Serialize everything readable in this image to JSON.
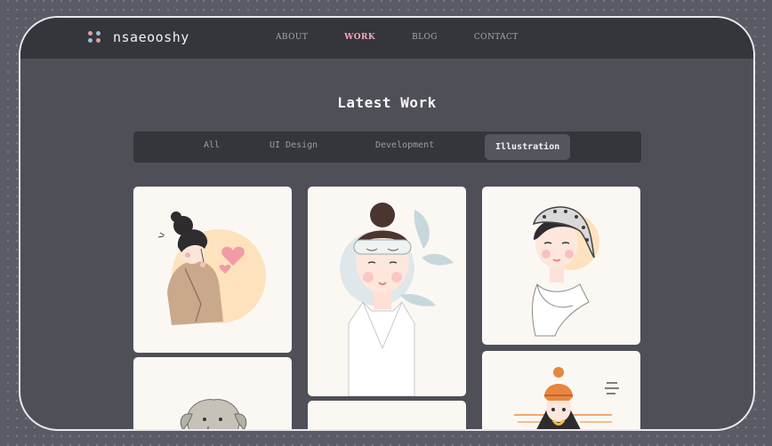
{
  "brand": {
    "name": "nsaeooshy"
  },
  "nav": [
    {
      "label": "ABOUT"
    },
    {
      "label": "WORK",
      "active": true
    },
    {
      "label": "BLOG"
    },
    {
      "label": "CONTACT"
    }
  ],
  "page": {
    "title": "Latest Work"
  },
  "filters": [
    {
      "label": "All"
    },
    {
      "label": "UI Design"
    },
    {
      "label": "Development"
    },
    {
      "label": "Illustration",
      "active": true
    }
  ],
  "colors": {
    "accent_pink": "#f0aab8",
    "accent_blue": "#9bbfd8",
    "header_bg": "#35353c",
    "panel_bg": "#4f4f58",
    "card_bg": "#fbf8f4"
  },
  "gallery": [
    {
      "subject": "girl-with-hearts-illustration"
    },
    {
      "subject": "girl-with-sleep-mask-illustration"
    },
    {
      "subject": "girl-with-polka-dot-headscarf-illustration"
    },
    {
      "subject": "elephant-illustration"
    },
    {
      "subject": "blank-card"
    },
    {
      "subject": "girl-in-orange-beanie-illustration"
    }
  ]
}
